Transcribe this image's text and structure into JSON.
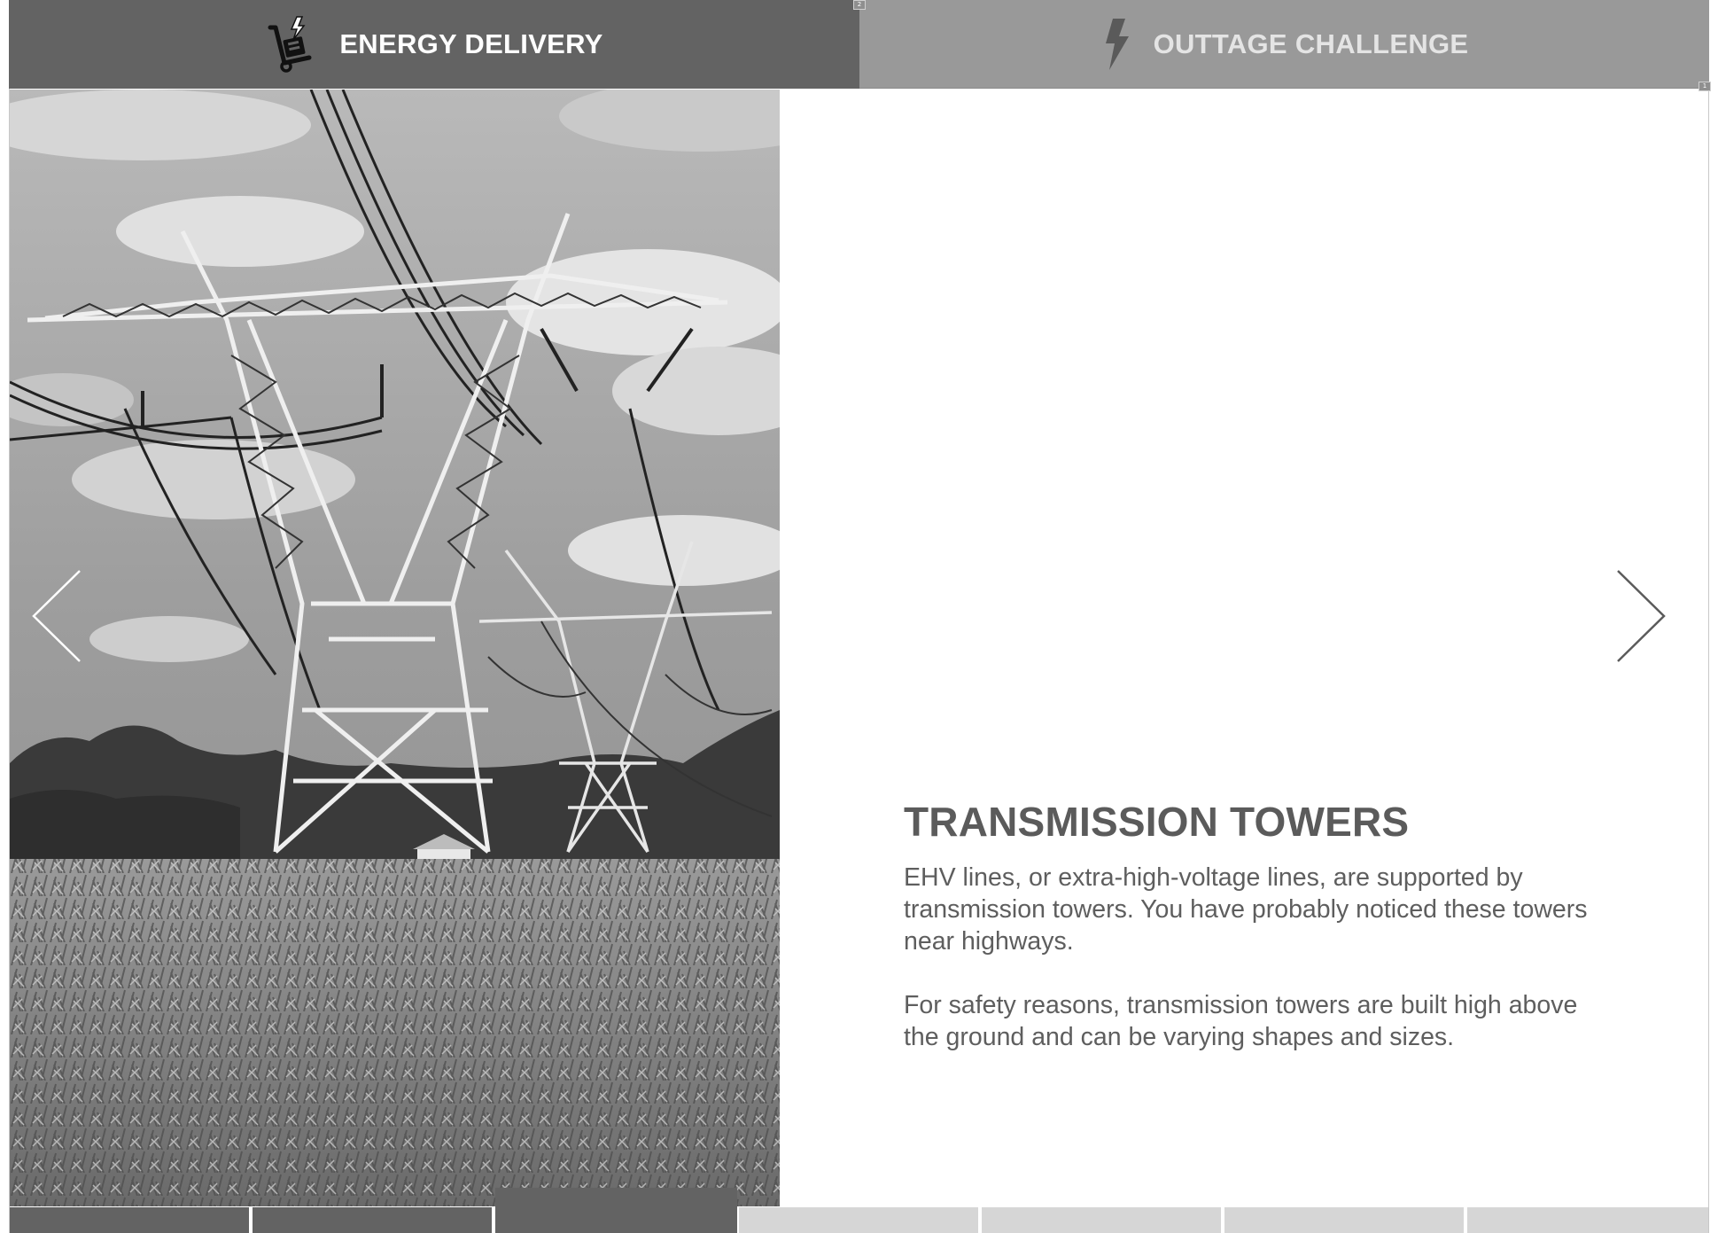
{
  "tabs": [
    {
      "label": "ENERGY DELIVERY",
      "icon": "hand-truck-lightning-icon",
      "active": true
    },
    {
      "label": "OUTTAGE CHALLENGE",
      "icon": "lightning-bolt-icon",
      "active": false
    }
  ],
  "corner_marks": {
    "top_center": "2",
    "top_right": "1"
  },
  "slide": {
    "image_alt": "Transmission towers over a cornfield",
    "title": "TRANSMISSION TOWERS",
    "paragraphs": [
      "EHV lines, or extra-high-voltage lines, are supported by transmission towers. You have probably noticed these towers near highways.",
      "For safety reasons, transmission towers are built high above the ground and can be varying shapes and sizes."
    ]
  },
  "navigation": {
    "prev_icon": "chevron-left-icon",
    "next_icon": "chevron-right-icon"
  },
  "progress": {
    "total": 7,
    "current": 3,
    "colors": {
      "done": "#636363",
      "todo": "#d6d6d6"
    }
  },
  "colors": {
    "tab_active": "#636363",
    "tab_inactive": "#999999",
    "text": "#5e5e5e"
  }
}
